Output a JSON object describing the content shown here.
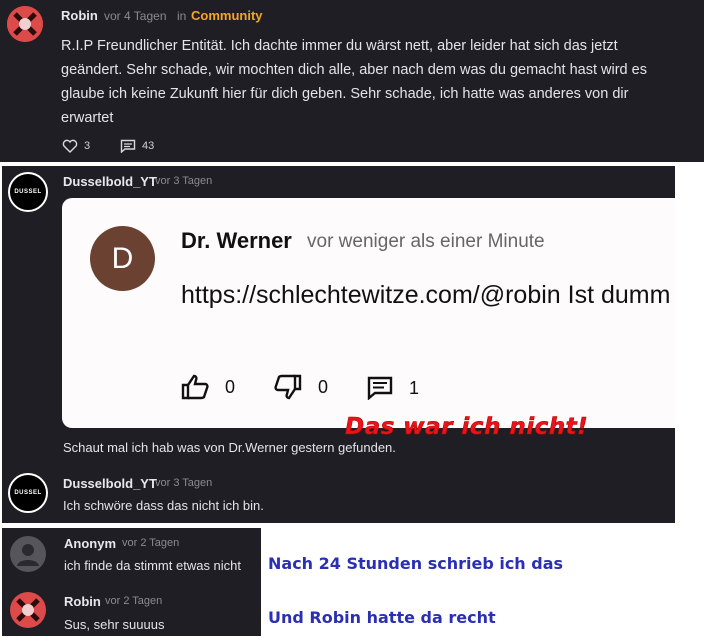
{
  "post1": {
    "author": "Robin",
    "time": "vor 4 Tagen",
    "in_word": "in",
    "community": "Community",
    "text": "R.I.P Freundlicher Entität. Ich dachte immer du wärst nett, aber leider hat sich das jetzt geändert. Sehr schade, wir mochten dich alle, aber nach dem was du gemacht hast wird es glaube ich keine Zukunft hier für dich geben. Sehr schade, ich hatte was anderes von dir erwartet",
    "likes": "3",
    "comments": "43"
  },
  "comment1": {
    "author": "Dusselbold_YT",
    "time": "vor 3 Tagen",
    "avatar_text": "DUSSEL",
    "text": "Schaut mal ich hab was von Dr.Werner gestern gefunden."
  },
  "embed": {
    "avatar_letter": "D",
    "author": "Dr. Werner",
    "time": "vor weniger als einer Minute",
    "text": "https://schlechtewitze.com/@robin Ist dumm",
    "likes": "0",
    "dislikes": "0",
    "comments": "1",
    "overlay": "Das war ich nicht!"
  },
  "comment2": {
    "author": "Dusselbold_YT",
    "time": "vor 3 Tagen",
    "avatar_text": "DUSSEL",
    "text": "Ich schwöre dass das nicht ich bin."
  },
  "comment3": {
    "author": "Anonym",
    "time": "vor 2 Tagen",
    "text": "ich finde da stimmt etwas nicht"
  },
  "comment4": {
    "author": "Robin",
    "time": "vor 2 Tagen",
    "text": "Sus, sehr suuuus"
  },
  "annotations": {
    "note1": "Nach 24 Stunden schrieb ich das",
    "note2": "Und Robin hatte da recht"
  },
  "colors": {
    "community": "#f5a623",
    "overlay_red": "#e8141c",
    "annotation_blue": "#2a2fb5",
    "panel_bg": "#1f1e24"
  }
}
